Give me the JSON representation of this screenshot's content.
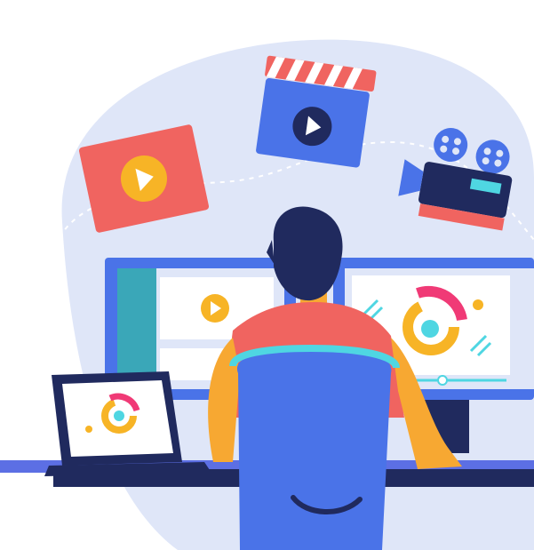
{
  "scene": {
    "subject": "video-editor-illustration",
    "elements": [
      "video-player-card",
      "clapperboard",
      "film-camera",
      "desktop-monitors",
      "laptop",
      "person",
      "office-chair",
      "desk"
    ],
    "colors": {
      "background_blob": "#dfe6f8",
      "accent_red": "#f06460",
      "accent_yellow": "#f7b426",
      "accent_blue": "#4a73e8",
      "navy": "#202a5e",
      "cyan": "#4fd6e2",
      "pink": "#f03a76",
      "skin": "#f7a832"
    }
  }
}
